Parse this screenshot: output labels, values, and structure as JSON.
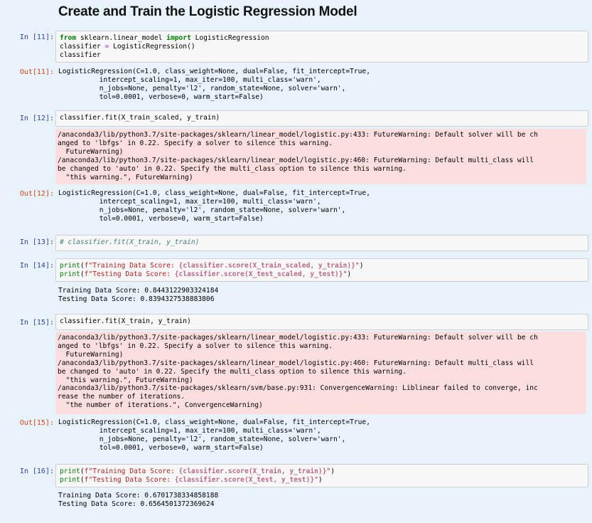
{
  "heading": "Create and Train the Logistic Regression Model",
  "cells": {
    "c11": {
      "in_prompt": "In [11]:",
      "l1_kw1": "from",
      "l1_mid": " sklearn.linear_model ",
      "l1_kw2": "import",
      "l1_end": " LogisticRegression",
      "l2_a": "classifier ",
      "l2_op": "=",
      "l2_b": " LogisticRegression()",
      "l3": "classifier",
      "out_prompt": "Out[11]:",
      "output": "LogisticRegression(C=1.0, class_weight=None, dual=False, fit_intercept=True,\n          intercept_scaling=1, max_iter=100, multi_class='warn',\n          n_jobs=None, penalty='l2', random_state=None, solver='warn',\n          tol=0.0001, verbose=0, warm_start=False)"
    },
    "c12": {
      "in_prompt": "In [12]:",
      "code": "classifier.fit(X_train_scaled, y_train)",
      "warning": "/anaconda3/lib/python3.7/site-packages/sklearn/linear_model/logistic.py:433: FutureWarning: Default solver will be ch\nanged to 'lbfgs' in 0.22. Specify a solver to silence this warning.\n  FutureWarning)\n/anaconda3/lib/python3.7/site-packages/sklearn/linear_model/logistic.py:460: FutureWarning: Default multi_class will\nbe changed to 'auto' in 0.22. Specify the multi_class option to silence this warning.\n  \"this warning.\", FutureWarning)",
      "out_prompt": "Out[12]:",
      "output": "LogisticRegression(C=1.0, class_weight=None, dual=False, fit_intercept=True,\n          intercept_scaling=1, max_iter=100, multi_class='warn',\n          n_jobs=None, penalty='l2', random_state=None, solver='warn',\n          tol=0.0001, verbose=0, warm_start=False)"
    },
    "c13": {
      "in_prompt": "In [13]:",
      "comment": "# classifier.fit(X_train, y_train)"
    },
    "c14": {
      "in_prompt": "In [14]:",
      "l1_fn": "print",
      "l1_a": "(",
      "l1_str1": "f\"Training Data Score: ",
      "l1_int": "{classifier.score(X_train_scaled, y_train)}",
      "l1_str2": "\"",
      "l1_b": ")",
      "l2_fn": "print",
      "l2_a": "(",
      "l2_str1": "f\"Testing Data Score: ",
      "l2_int": "{classifier.score(X_test_scaled, y_test)}",
      "l2_str2": "\"",
      "l2_b": ")",
      "output": "Training Data Score: 0.8443122903324184\nTesting Data Score: 0.8394327538883806"
    },
    "c15": {
      "in_prompt": "In [15]:",
      "code": "classifier.fit(X_train, y_train)",
      "warning": "/anaconda3/lib/python3.7/site-packages/sklearn/linear_model/logistic.py:433: FutureWarning: Default solver will be ch\nanged to 'lbfgs' in 0.22. Specify a solver to silence this warning.\n  FutureWarning)\n/anaconda3/lib/python3.7/site-packages/sklearn/linear_model/logistic.py:460: FutureWarning: Default multi_class will\nbe changed to 'auto' in 0.22. Specify the multi_class option to silence this warning.\n  \"this warning.\", FutureWarning)\n/anaconda3/lib/python3.7/site-packages/sklearn/svm/base.py:931: ConvergenceWarning: Liblinear failed to converge, inc\nrease the number of iterations.\n  \"the number of iterations.\", ConvergenceWarning)",
      "out_prompt": "Out[15]:",
      "output": "LogisticRegression(C=1.0, class_weight=None, dual=False, fit_intercept=True,\n          intercept_scaling=1, max_iter=100, multi_class='warn',\n          n_jobs=None, penalty='l2', random_state=None, solver='warn',\n          tol=0.0001, verbose=0, warm_start=False)"
    },
    "c16": {
      "in_prompt": "In [16]:",
      "l1_fn": "print",
      "l1_a": "(",
      "l1_str1": "f\"Training Data Score: ",
      "l1_int": "{classifier.score(X_train, y_train)}",
      "l1_str2": "\"",
      "l1_b": ")",
      "l2_fn": "print",
      "l2_a": "(",
      "l2_str1": "f\"Testing Data Score: ",
      "l2_int": "{classifier.score(X_test, y_test)}",
      "l2_str2": "\"",
      "l2_b": ")",
      "output": "Training Data Score: 0.6701738334858188\nTesting Data Score: 0.6564501372369624"
    }
  }
}
